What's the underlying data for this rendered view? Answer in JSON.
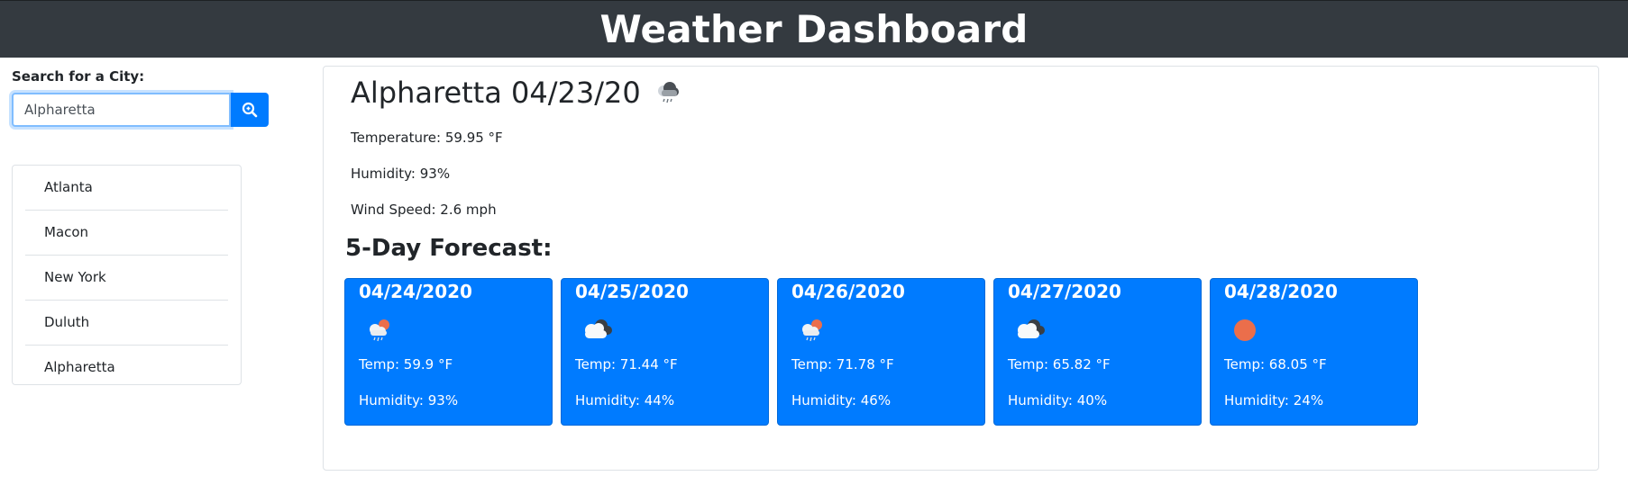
{
  "header": {
    "title": "Weather Dashboard"
  },
  "search": {
    "label": "Search for a City:",
    "value": "Alpharetta",
    "button_icon": "search-icon"
  },
  "cities": [
    "Atlanta",
    "Macon",
    "New York",
    "Duluth",
    "Alpharetta"
  ],
  "current": {
    "title": "Alpharetta 04/23/20",
    "icon": "rain-cloud-icon",
    "temperature": "Temperature: 59.95 °F",
    "humidity": "Humidity: 93%",
    "wind": "Wind Speed: 2.6 mph"
  },
  "forecast": {
    "heading": "5-Day Forecast:",
    "days": [
      {
        "date": "04/24/2020",
        "icon": "sun-cloud-rain-icon",
        "temp": "Temp: 59.9 °F",
        "humidity": "Humidity: 93%"
      },
      {
        "date": "04/25/2020",
        "icon": "broken-clouds-icon",
        "temp": "Temp: 71.44 °F",
        "humidity": "Humidity: 44%"
      },
      {
        "date": "04/26/2020",
        "icon": "sun-cloud-rain-icon",
        "temp": "Temp: 71.78 °F",
        "humidity": "Humidity: 46%"
      },
      {
        "date": "04/27/2020",
        "icon": "broken-clouds-icon",
        "temp": "Temp: 65.82 °F",
        "humidity": "Humidity: 40%"
      },
      {
        "date": "04/28/2020",
        "icon": "sun-icon",
        "temp": "Temp: 68.05 °F",
        "humidity": "Humidity: 24%"
      }
    ]
  },
  "colors": {
    "navbar": "#343a40",
    "primary": "#007bff",
    "sun": "#eb6e4b"
  }
}
